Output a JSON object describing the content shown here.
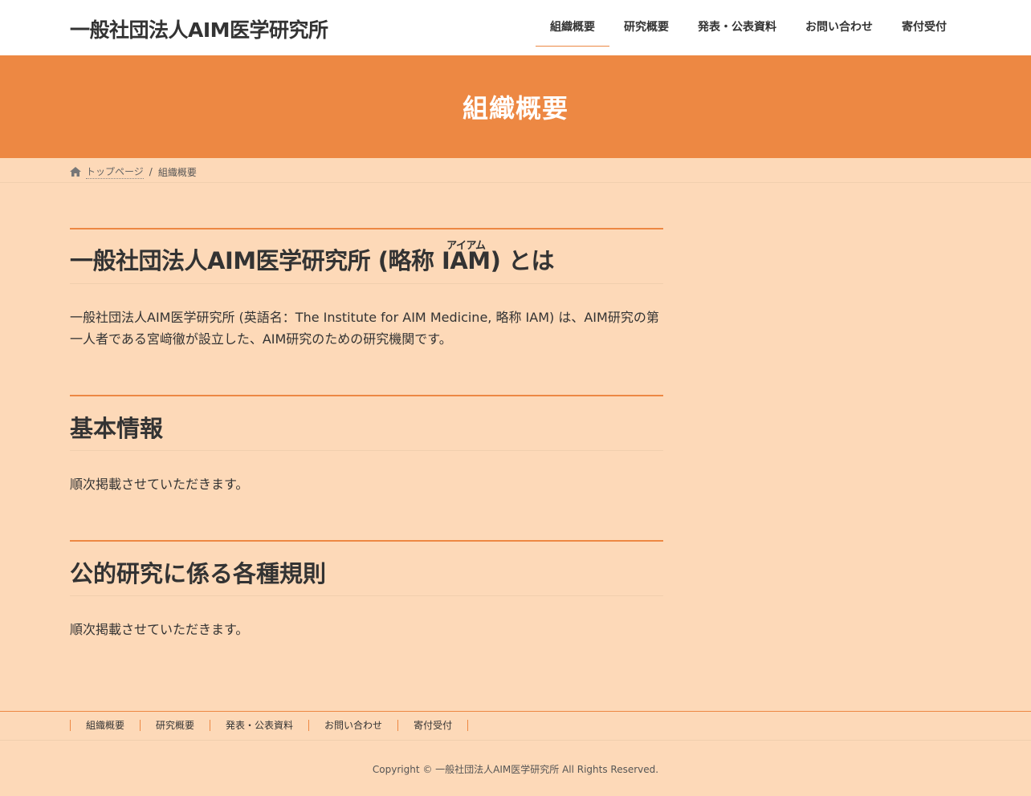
{
  "site": {
    "title": "一般社団法人AIM医学研究所"
  },
  "nav": {
    "items": [
      "組織概要",
      "研究概要",
      "発表・公表資料",
      "お問い合わせ",
      "寄付受付"
    ],
    "active": "組織概要"
  },
  "page_header": {
    "title": "組織概要"
  },
  "breadcrumb": {
    "icon": "home-icon",
    "home": "トップページ",
    "separator": "/",
    "current": "組織概要"
  },
  "sections": [
    {
      "title_prefix": "一般社団法人AIM医学研究所 (略称 ",
      "title_ruby_base": "IAM",
      "title_ruby_text": "アイアム",
      "title_suffix": ") とは",
      "body": "一般社団法人AIM医学研究所 (英語名：The Institute for AIM Medicine, 略称 IAM) は、AIM研究の第一人者である宮﨑徹が設立した、AIM研究のための研究機関です。"
    },
    {
      "title": "基本情報",
      "body": "順次掲載させていただきます。"
    },
    {
      "title": "公的研究に係る各種規則",
      "body": "順次掲載させていただきます。"
    }
  ],
  "footer": {
    "nav": [
      "組織概要",
      "研究概要",
      "発表・公表資料",
      "お問い合わせ",
      "寄付受付"
    ],
    "copyright": "Copyright © 一般社団法人AIM医学研究所 All Rights Reserved."
  },
  "colors": {
    "accent": "#ed8843",
    "background": "#fdd9b8",
    "header_bg": "#ffffff"
  }
}
